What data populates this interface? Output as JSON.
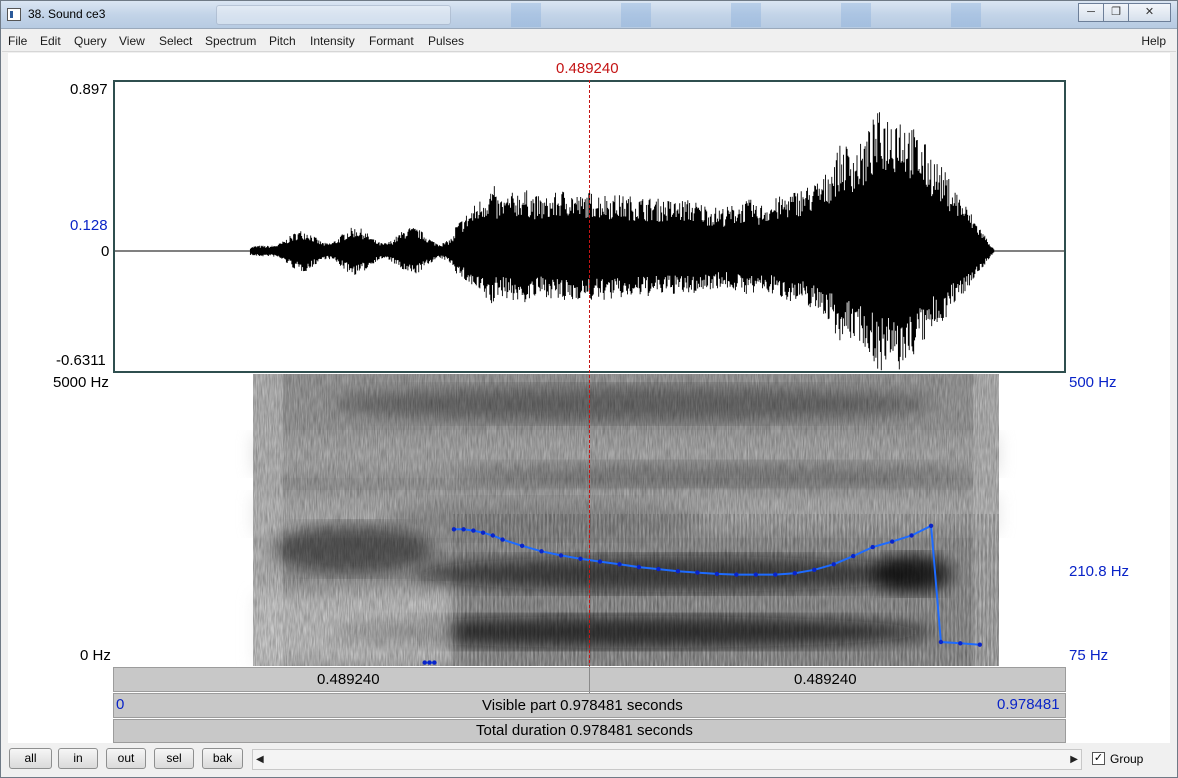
{
  "window": {
    "title": "38. Sound ce3"
  },
  "menu": {
    "items": [
      "File",
      "Edit",
      "Query",
      "View",
      "Select",
      "Spectrum",
      "Pitch",
      "Intensity",
      "Formant",
      "Pulses"
    ],
    "help": "Help"
  },
  "cursor": {
    "time_label": "0.489240",
    "time": 0.48924
  },
  "waveform": {
    "ymax_label": "0.897",
    "ymin_label": "-0.6311",
    "zero_label": "0",
    "cursor_value_label": "0.128"
  },
  "spectrogram": {
    "top_label": "5000 Hz",
    "bottom_label": "0 Hz",
    "pitch_top_label": "500 Hz",
    "pitch_bottom_label": "75 Hz",
    "pitch_cursor_label": "210.8 Hz"
  },
  "pitch_track": {
    "time_range_s": [
      0,
      0.978481
    ],
    "pitch_range_hz": [
      75,
      500
    ],
    "points": [
      [
        0.32,
        80
      ],
      [
        0.325,
        80
      ],
      [
        0.33,
        80
      ],
      [
        0.35,
        274
      ],
      [
        0.36,
        274
      ],
      [
        0.37,
        272
      ],
      [
        0.38,
        269
      ],
      [
        0.39,
        265
      ],
      [
        0.4,
        259
      ],
      [
        0.42,
        250
      ],
      [
        0.44,
        242
      ],
      [
        0.46,
        236
      ],
      [
        0.48,
        231
      ],
      [
        0.5,
        227
      ],
      [
        0.52,
        223
      ],
      [
        0.54,
        219
      ],
      [
        0.56,
        216
      ],
      [
        0.58,
        213
      ],
      [
        0.6,
        211
      ],
      [
        0.62,
        209
      ],
      [
        0.64,
        208
      ],
      [
        0.66,
        208
      ],
      [
        0.68,
        208
      ],
      [
        0.7,
        210
      ],
      [
        0.72,
        215
      ],
      [
        0.74,
        223
      ],
      [
        0.76,
        235
      ],
      [
        0.78,
        248
      ],
      [
        0.8,
        256
      ],
      [
        0.82,
        265
      ],
      [
        0.84,
        279
      ],
      [
        0.85,
        110
      ],
      [
        0.87,
        108
      ],
      [
        0.89,
        106
      ]
    ]
  },
  "bars": {
    "left_segment": "0.489240",
    "right_segment": "0.489240",
    "visible_part": "Visible part 0.978481 seconds",
    "visible_start": "0",
    "visible_end": "0.978481",
    "total_duration": "Total duration 0.978481 seconds"
  },
  "buttons": {
    "all": "all",
    "in": "in",
    "out": "out",
    "sel": "sel",
    "bak": "bak"
  },
  "group": {
    "label": "Group",
    "checked": true
  },
  "colors": {
    "cursor": "#c41414",
    "pitch": "#0a24c8",
    "label_blue": "#0a24c8"
  }
}
